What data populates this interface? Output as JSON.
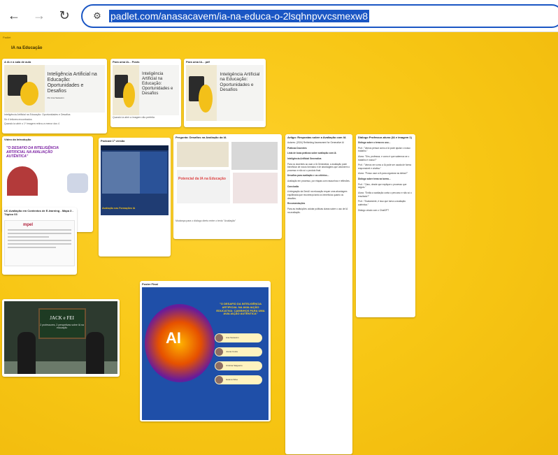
{
  "browser": {
    "back_icon": "←",
    "forward_icon": "→",
    "reload_icon": "↻",
    "site_info_icon": "⚙",
    "url": "padlet.com/anasacavem/ia-na-educa-o-2lsqhnpvvcsmexw8"
  },
  "board": {
    "header": "Padlet",
    "title": "IA na Educação"
  },
  "cards": {
    "ai_article": {
      "title": "A IA e a sala de aula",
      "thumb_text": "Inteligência Artificial na Educação: Oportunidades e Desafios",
      "author": "Por Ana Sacavém",
      "caption": "Inteligência Artificial na Educação: Oportunidades e Desafios",
      "note1": "Só 4 leitores encontrados",
      "note2": "Quando ia abrir o 1º imagem retirou a menor dos 4"
    },
    "ai_article2": {
      "title": "Para uma IA... Posts",
      "thumb_text": "Inteligência Artificial na Educação: Oportunidades e Desafios",
      "caption": "Quando ia abrir a imagem não perfeita"
    },
    "ai_article3": {
      "title": "Para uma IA... pdf",
      "thumb_text": "Inteligência Artificial na Educação: Oportunidades e Desafios"
    },
    "video": {
      "title": "Vídeo da Introdução",
      "headline": "\"O DESAFIO DA INTELIGÊNCIA ARTIFICIAL NA AVALIAÇÃO AUTÊNTICA\""
    },
    "podcast": {
      "title": "Podcast 1ª versão",
      "caption": "Avaliação nas Formações IA"
    },
    "screenshots": {
      "title": "Pergunta: Desafios na Avaliação da IA",
      "label": "Potencial da IA na Educação",
      "caption": "Mudança para o diálogo direto entre o texto \"Avaliação\""
    },
    "article_text": {
      "title": "Artigo: Respostas sobre a Avaliação com IA",
      "text": [
        "Autores: (2024) Rethinking Assessment for Generative AI",
        "Práticas Docentes",
        "Lista de boas práticas sobre avaliação com IA",
        "Inteligência Artificial Generativa",
        "Para os docentes ao usar a IA Generativa, a avaliação pode beneficiar de novos formatos e de abordagens que valorizem o processo e não só o produto final.",
        "Desafios para avaliação e os critérios...",
        "Avaliação em processo, por etapas com rascunhos e reflexões.",
        "Conclusão",
        "A integração da GenAI na educação requer uma abordagem equilibrada que reconheça tanto os benefícios quanto os desafios.",
        "Recomendações",
        "Para as instituições: adotar políticas claras sobre o uso de IA na avaliação."
      ]
    },
    "dialogue": {
      "title": "Diálogo Professor-aluno (IA e imagem 1)",
      "subtitle1": "Diálogo sobre o tema no uso...",
      "subtitle2": "Diálogo sobre tema na turma...",
      "lines": [
        "Prof.: \"Vamos pensar como a IA pode ajudar o nosso trabalho.\"",
        "Aluno: \"Sim, professor, e como é que sabemos se o trabalho é nosso?\"",
        "Prof.: \"Vamos ver como a IA pode ser usada de forma responsável e criativa.\"",
        "Aluno: \"Posso usar a IA para organizar as ideias?\"",
        "Prof.: \"Claro, desde que explique o processo que seguiu.\"",
        "Aluno: \"Então a avaliação conta o percurso e não só o resultado?\"",
        "Prof.: \"Exatamente, é isso que torna a avaliação autêntica.\""
      ],
      "footer": "Diálogo criado com o ChatGPT"
    },
    "mpal": {
      "title": "UC Avaliação em Contextos de E-learning - Mapa 3 - Tópico 03",
      "logo": "mpel"
    },
    "jack": {
      "board_title": "JACK e FEI",
      "board_sub": "2 professores, 2 perspetivas sobre IA na educação"
    },
    "poster": {
      "title": "Poster Final",
      "headline": "\"O DESAFIO DA INTELIGÊNCIA ARTIFICIAL NA AVALIAÇÃO EDUCATIVA: CAMINHOS PARA UMA AVALIAÇÃO AUTÊNTICA\"",
      "ai": "AI",
      "people": [
        "Ana Sacavém",
        "Joana Costa",
        "Cristina Salgueiro",
        "Helena Silva"
      ]
    }
  }
}
